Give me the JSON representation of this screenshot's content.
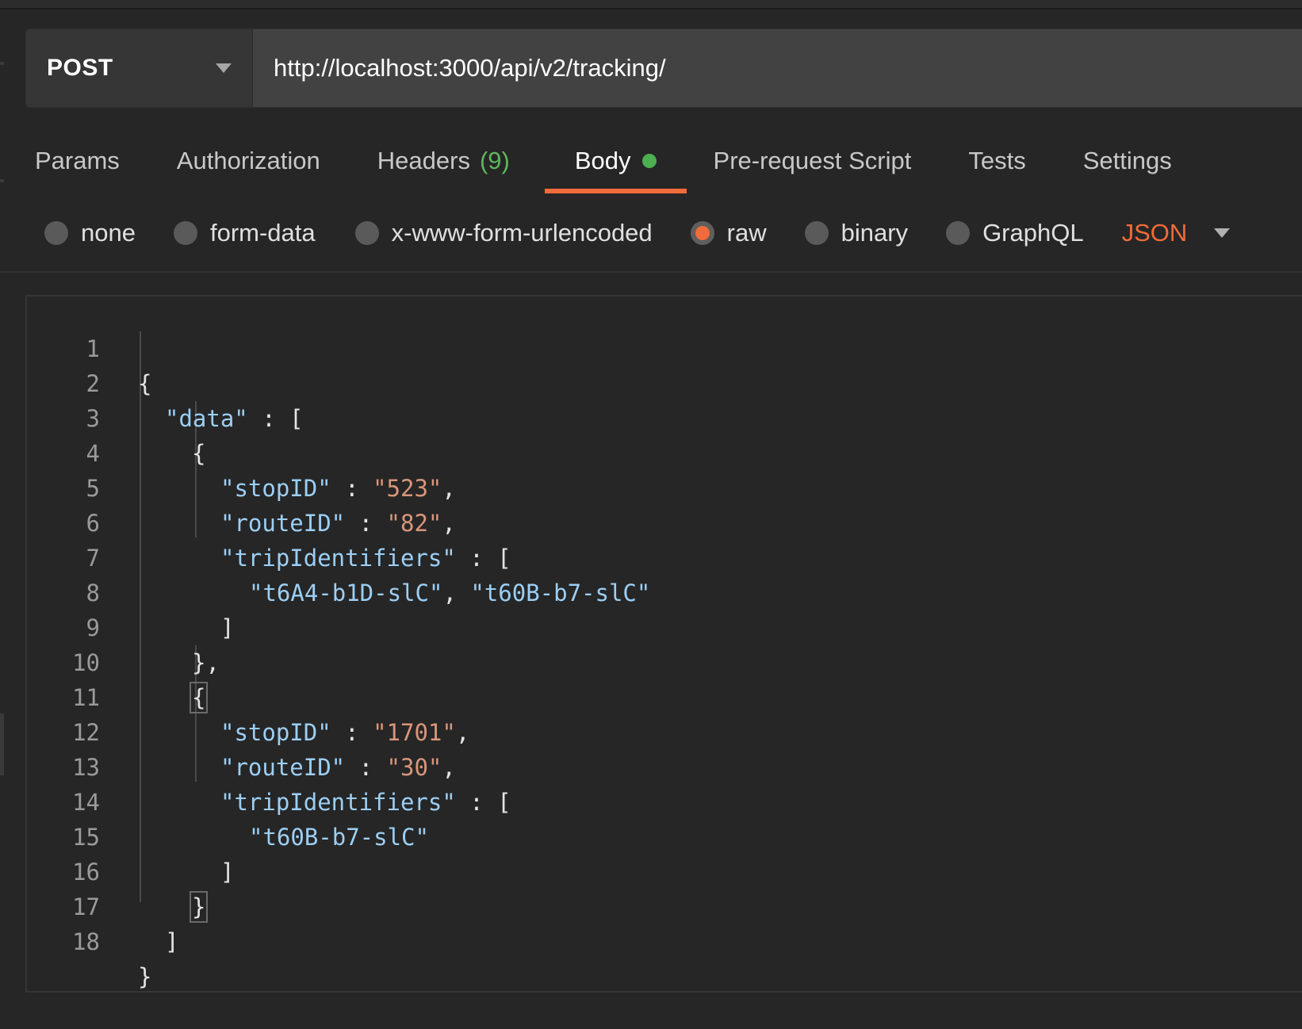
{
  "request": {
    "method": "POST",
    "url": "http://localhost:3000/api/v2/tracking/"
  },
  "tabs": [
    {
      "label": "Params"
    },
    {
      "label": "Authorization"
    },
    {
      "label": "Headers",
      "count": "(9)"
    },
    {
      "label": "Body",
      "active": true
    },
    {
      "label": "Pre-request Script"
    },
    {
      "label": "Tests"
    },
    {
      "label": "Settings"
    }
  ],
  "body_types": {
    "options": [
      "none",
      "form-data",
      "x-www-form-urlencoded",
      "raw",
      "binary",
      "GraphQL"
    ],
    "selected": "raw",
    "format": "JSON"
  },
  "editor": {
    "line_numbers": [
      "1",
      "2",
      "3",
      "4",
      "5",
      "6",
      "7",
      "8",
      "9",
      "10",
      "11",
      "12",
      "13",
      "14",
      "15",
      "16",
      "17",
      "18"
    ],
    "tokens": {
      "open_brace": "{",
      "close_brace": "}",
      "data_key": "\"data\"",
      "colon_bracket": " : [",
      "close_bracket": "]",
      "close_obj_comma": "},",
      "stop_key": "\"stopID\"",
      "route_key": "\"routeID\"",
      "trip_key": "\"tripIdentifiers\"",
      "colon": " : ",
      "comma": ",",
      "stop1": "\"523\"",
      "route1": "\"82\"",
      "trip1a": "\"t6A4-b1D-slC\"",
      "trip1b": "\"t60B-b7-slC\"",
      "stop2": "\"1701\"",
      "route2": "\"30\"",
      "trip2a": "\"t60B-b7-slC\""
    }
  },
  "colors": {
    "accent": "#f26b3a",
    "active_dot": "#4caf50",
    "json_key": "#9ccff5",
    "json_string": "#d9967a"
  }
}
